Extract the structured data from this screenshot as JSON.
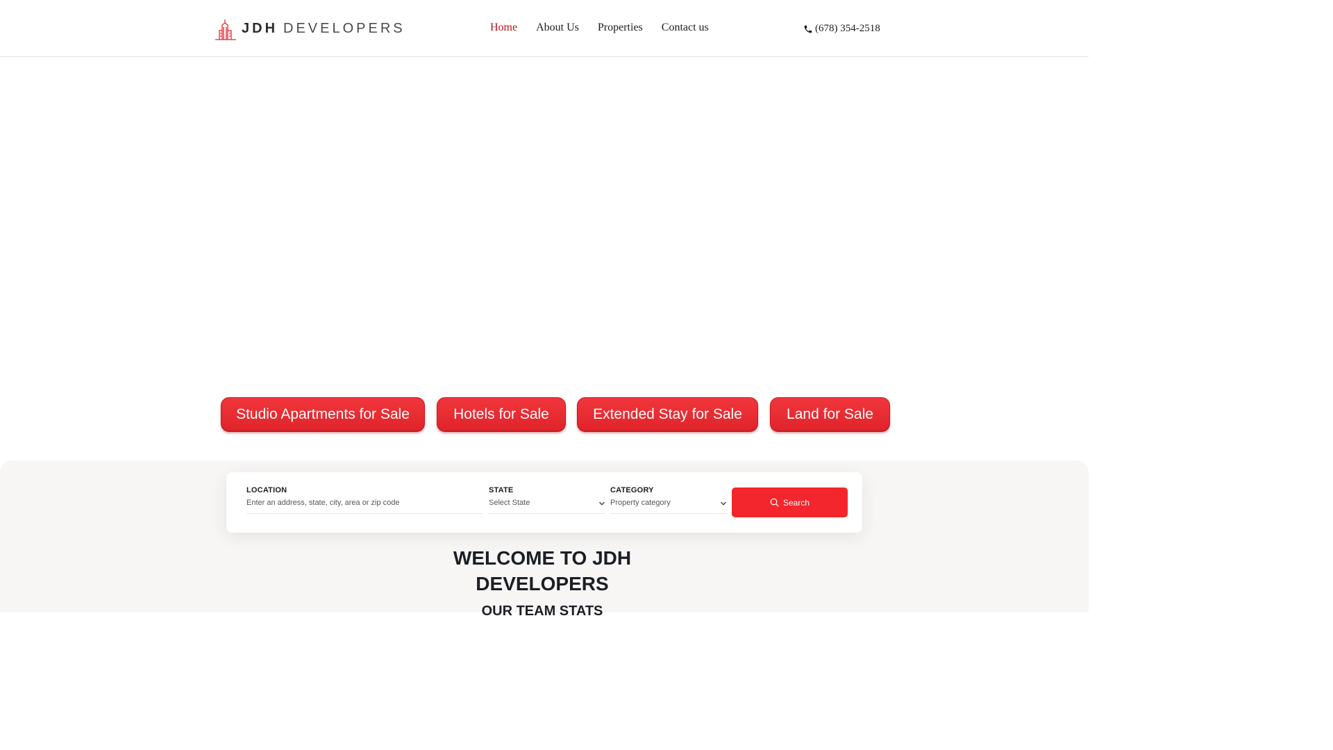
{
  "header": {
    "logo": {
      "bold": "JDH",
      "light": "DEVELOPERS",
      "icon": "building-logo-icon",
      "accent": "#e8262d"
    },
    "nav": [
      {
        "label": "Home",
        "active": true
      },
      {
        "label": "About Us",
        "active": false
      },
      {
        "label": "Properties",
        "active": false
      },
      {
        "label": "Contact us",
        "active": false
      }
    ],
    "phone": {
      "icon": "phone-icon",
      "number": "(678) 354-2518"
    }
  },
  "categories": [
    {
      "label": "Studio Apartments for Sale"
    },
    {
      "label": "Hotels for Sale"
    },
    {
      "label": "Extended Stay for Sale"
    },
    {
      "label": "Land for Sale"
    }
  ],
  "search": {
    "location": {
      "label": "LOCATION",
      "placeholder": "Enter an address, state, city, area or zip code"
    },
    "state": {
      "label": "STATE",
      "value": "Select State",
      "icon": "chevron-down-icon"
    },
    "category": {
      "label": "CATEGORY",
      "value": "Property category",
      "icon": "chevron-down-icon"
    },
    "button": {
      "label": "Search",
      "icon": "search-icon"
    }
  },
  "welcome": {
    "line1": "WELCOME TO JDH",
    "line2": "DEVELOPERS"
  },
  "stats": {
    "title": "OUR TEAM STATS"
  },
  "colors": {
    "brand_red": "#f2262c",
    "nav_active": "#b3101a",
    "section_bg": "#f7f6f5"
  }
}
